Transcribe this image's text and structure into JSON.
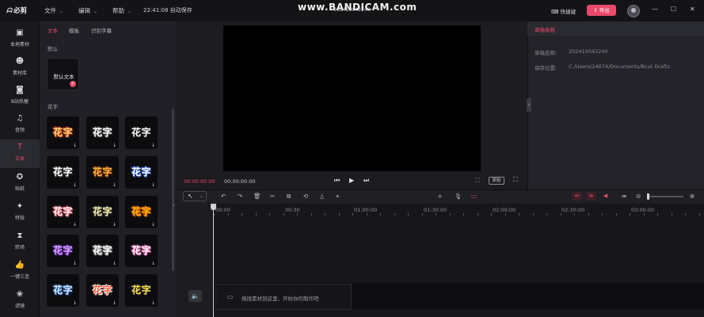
{
  "app": {
    "logo_mark": "ᗣ",
    "name": "必剪",
    "project_name": "202410042240",
    "watermark": "www.BANDICAM.com",
    "autosave": "22:41:08 自动保存"
  },
  "menu": [
    {
      "label": "文件"
    },
    {
      "label": "编辑"
    },
    {
      "label": "帮助"
    }
  ],
  "header": {
    "shortcut_label": "⌨ 快捷键",
    "export_label": "⇪ 导出",
    "win_min": "—",
    "win_max": "☐",
    "win_close": "✕"
  },
  "rail": [
    {
      "icon": "▣",
      "label": "本地素材"
    },
    {
      "icon": "☻",
      "label": "素材库"
    },
    {
      "icon": "◙",
      "label": "B站热梗"
    },
    {
      "icon": "♫",
      "label": "音频"
    },
    {
      "icon": "T",
      "label": "文本"
    },
    {
      "icon": "✪",
      "label": "贴纸"
    },
    {
      "icon": "✦",
      "label": "特效"
    },
    {
      "icon": "⧗",
      "label": "转场"
    },
    {
      "icon": "👍",
      "label": "一键三连"
    },
    {
      "icon": "❀",
      "label": "滤镜"
    }
  ],
  "panel": {
    "tabs": [
      "文本",
      "模板",
      "识别字幕"
    ],
    "section_default": "默认",
    "default_text": "默认文本",
    "section_fancy": "花字",
    "tile_text": "花字",
    "download_glyph": "↓"
  },
  "tiles": [
    {
      "color": "#ffd27a",
      "shadow": "#c2401a"
    },
    {
      "color": "#ffffff",
      "shadow": "#555555"
    },
    {
      "color": "#ffffff",
      "shadow": "#222222"
    },
    {
      "color": "#ffffff",
      "shadow": "#444444"
    },
    {
      "color": "#ffb13b",
      "shadow": "#7a3a10"
    },
    {
      "color": "#ffffff",
      "shadow": "#2d5dc9"
    },
    {
      "color": "#fff3f3",
      "shadow": "#e05b6e"
    },
    {
      "color": "#f7f3a8",
      "shadow": "#3d3d3d"
    },
    {
      "color": "#ffb300",
      "shadow": "#c2540a"
    },
    {
      "color": "#d6a7ff",
      "shadow": "#6a2aa8"
    },
    {
      "color": "#f8f8f8",
      "shadow": "#8a8a8a"
    },
    {
      "color": "#ffffff",
      "shadow": "#d04b9a"
    },
    {
      "color": "#cfe8ff",
      "shadow": "#2b5c9e"
    },
    {
      "color": "#ff5d3a",
      "shadow": "#ffffff"
    },
    {
      "color": "#ffe14a",
      "shadow": "#2b2b2b"
    }
  ],
  "player": {
    "current_time": "00:00:00.00",
    "total_time": "00:00:00.00",
    "prev": "⏮",
    "play": "▶",
    "next": "⏭",
    "crop": "⛶",
    "original_label": "原始",
    "fullscreen": "⛶"
  },
  "props": {
    "title": "草稿参数",
    "name_key": "草稿名称:",
    "name_value": "202410042240",
    "path_key": "保存位置:",
    "path_value": "C:/Users/24074/Documents/Bcut Drafts",
    "handle": "›"
  },
  "timeline": {
    "tools": [
      "↶",
      "↷",
      "🗑",
      "✂",
      "⧉",
      "⟲",
      "⏃",
      "⌖"
    ],
    "right_tools": [
      "⟡",
      "🎙",
      "▭"
    ],
    "red_tools": [
      "⇔",
      "⇹",
      "◀"
    ],
    "split": "⇹",
    "zoom_out": "⊖",
    "zoom_in": "⊕",
    "ticks": [
      "00:00",
      "00:30",
      "01:00:00",
      "01:30:00",
      "02:00:00",
      "02:30:00",
      "03:00:00"
    ],
    "drop_hint": "拖拽素材到这里，开始你的制作吧",
    "mute": "🔈"
  }
}
